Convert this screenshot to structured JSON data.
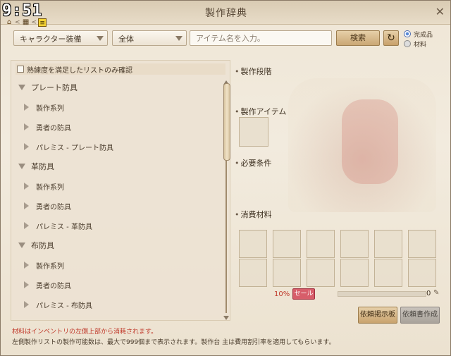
{
  "clock": "9:51",
  "window": {
    "title": "製作辞典",
    "close_label": "✕"
  },
  "breadcrumb": {
    "sep": "<"
  },
  "toolbar": {
    "category_select": "キャラクター装備",
    "scope_select": "全体",
    "search_placeholder": "アイテム名を入力。",
    "search_label": "検索",
    "refresh_glyph": "↻"
  },
  "mode": {
    "options": [
      {
        "label": "完成品",
        "selected": true
      },
      {
        "label": "材料",
        "selected": false
      }
    ]
  },
  "filter": {
    "label": "熟練度を満足したリストのみ確認",
    "checked": false
  },
  "tree": [
    {
      "label": "プレート防具",
      "children": [
        "製作系列",
        "勇者の防具",
        "パレミス - プレート防具"
      ]
    },
    {
      "label": "革防具",
      "children": [
        "製作系列",
        "勇者の防具",
        "パレミス - 革防具"
      ]
    },
    {
      "label": "布防具",
      "children": [
        "製作系列",
        "勇者の防具",
        "パレミス - 布防具"
      ]
    }
  ],
  "details": {
    "stage_label": "製作段階",
    "item_label": "製作アイテム",
    "requirements_label": "必要条件",
    "materials_label": "消費材料"
  },
  "cost": {
    "discount": "10%",
    "sale_badge": "セール",
    "value": "0"
  },
  "actions": {
    "board_label": "依頼掲示板",
    "create_label": "依頼書作成"
  },
  "notes": {
    "red": "材料はインベントリの左側上部から消耗されます。",
    "gray": "左側製作リストの製作可能数は、最大で999個まで表示されます。製作台 主は費用割引率を適用してもらいます。"
  },
  "colors": {
    "accent_red": "#c0392b",
    "sale": "#d75d6a",
    "button": "#caa774"
  }
}
